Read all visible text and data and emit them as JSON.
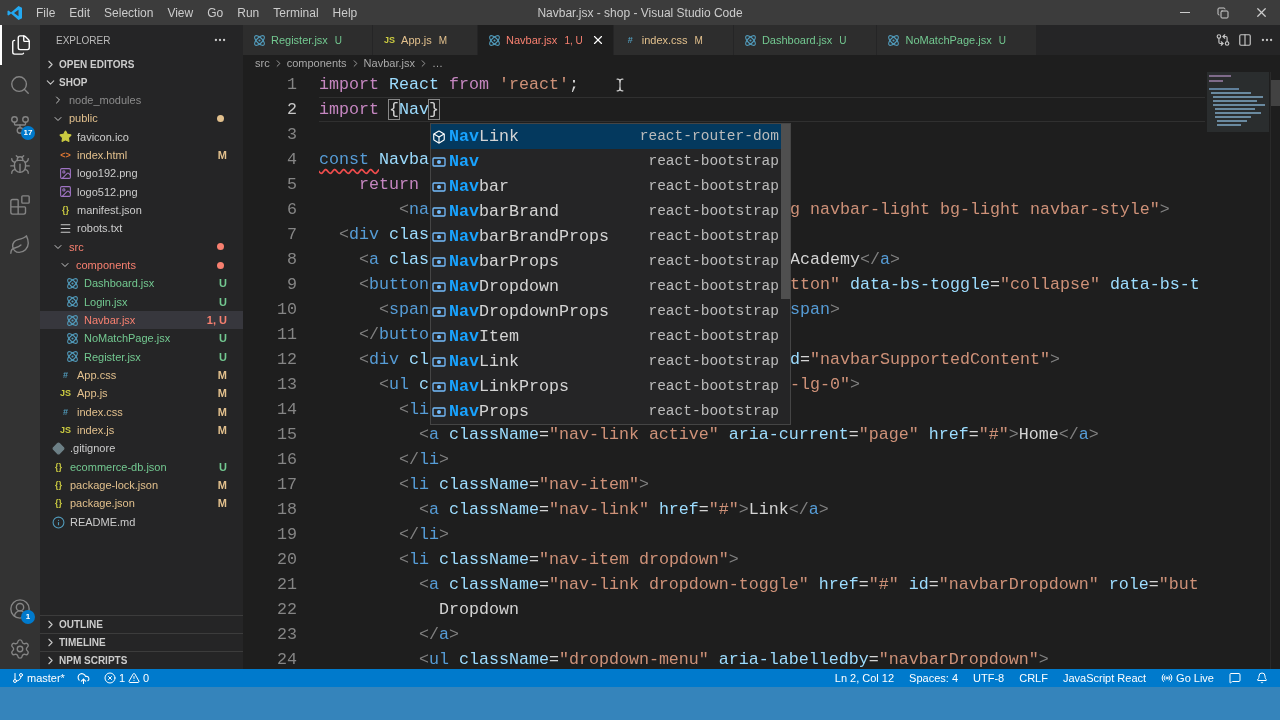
{
  "window": {
    "title": "Navbar.jsx - shop - Visual Studio Code"
  },
  "menu": [
    "File",
    "Edit",
    "Selection",
    "View",
    "Go",
    "Run",
    "Terminal",
    "Help"
  ],
  "activity_bar": {
    "top": [
      {
        "kind": "explorer",
        "selected": true
      },
      {
        "kind": "search",
        "selected": false
      },
      {
        "kind": "source_control",
        "selected": false,
        "badge": "17"
      },
      {
        "kind": "run",
        "selected": false
      },
      {
        "kind": "extensions",
        "selected": false
      },
      {
        "kind": "leaf",
        "selected": false
      }
    ],
    "bottom": [
      {
        "kind": "account",
        "badge": "1"
      },
      {
        "kind": "settings"
      }
    ]
  },
  "sidebar": {
    "title": "EXPLORER",
    "sections": [
      {
        "title": "OPEN EDITORS",
        "expanded": false
      },
      {
        "title": "SHOP",
        "expanded": true,
        "tree": [
          {
            "name": "node_modules",
            "kind": "folder",
            "expanded": false,
            "changed": false,
            "color": "#8c8c8c",
            "selected": false
          },
          {
            "name": "public",
            "kind": "folder",
            "expanded": true,
            "changed": true,
            "color": "#e2c08d",
            "selected": false,
            "children": [
              {
                "name": "favicon.ico",
                "kind": "favicon",
                "color": "#cccccc",
                "selected": false
              },
              {
                "name": "index.html",
                "kind": "html",
                "glyph": "<>",
                "color": "#e2c08d",
                "status": "M",
                "selected": false
              },
              {
                "name": "logo192.png",
                "kind": "image",
                "color": "#cccccc",
                "selected": false
              },
              {
                "name": "logo512.png",
                "kind": "image",
                "color": "#cccccc",
                "selected": false
              },
              {
                "name": "manifest.json",
                "kind": "json",
                "glyph": "{}",
                "color": "#cccccc",
                "selected": false
              },
              {
                "name": "robots.txt",
                "kind": "text",
                "color": "#cccccc",
                "selected": false
              }
            ]
          },
          {
            "name": "src",
            "kind": "folder",
            "expanded": true,
            "changed": true,
            "color": "#f88070",
            "selected": false,
            "children": [
              {
                "name": "components",
                "kind": "folder",
                "expanded": true,
                "changed": true,
                "color": "#f88070",
                "selected": false,
                "children": [
                  {
                    "name": "Dashboard.jsx",
                    "kind": "react",
                    "color": "#73c991",
                    "status": "U",
                    "selected": false
                  },
                  {
                    "name": "Login.jsx",
                    "kind": "react",
                    "color": "#73c991",
                    "status": "U",
                    "selected": false
                  },
                  {
                    "name": "Navbar.jsx",
                    "kind": "react",
                    "color": "#f88070",
                    "status": "1, U",
                    "selected": true
                  },
                  {
                    "name": "NoMatchPage.jsx",
                    "kind": "react",
                    "color": "#73c991",
                    "status": "U",
                    "selected": false
                  },
                  {
                    "name": "Register.jsx",
                    "kind": "react",
                    "color": "#73c991",
                    "status": "U",
                    "selected": false
                  }
                ]
              },
              {
                "name": "App.css",
                "kind": "css",
                "glyph": "#",
                "color": "#e2c08d",
                "status": "M",
                "selected": false
              },
              {
                "name": "App.js",
                "kind": "js",
                "glyph": "JS",
                "color": "#e2c08d",
                "status": "M",
                "selected": false
              },
              {
                "name": "index.css",
                "kind": "css",
                "glyph": "#",
                "color": "#e2c08d",
                "status": "M",
                "selected": false
              },
              {
                "name": "index.js",
                "kind": "js",
                "glyph": "JS",
                "color": "#e2c08d",
                "status": "M",
                "selected": false
              }
            ]
          },
          {
            "name": ".gitignore",
            "kind": "git",
            "color": "#cccccc",
            "selected": false
          },
          {
            "name": "ecommerce-db.json",
            "kind": "json",
            "glyph": "{}",
            "color": "#73c991",
            "status": "U",
            "selected": false
          },
          {
            "name": "package-lock.json",
            "kind": "json",
            "glyph": "{}",
            "color": "#e2c08d",
            "status": "M",
            "selected": false
          },
          {
            "name": "package.json",
            "kind": "json",
            "glyph": "{}",
            "color": "#e2c08d",
            "status": "M",
            "selected": false
          },
          {
            "name": "README.md",
            "kind": "info",
            "color": "#cccccc",
            "selected": false
          }
        ]
      }
    ],
    "bottom_sections": [
      {
        "title": "OUTLINE",
        "expanded": false
      },
      {
        "title": "TIMELINE",
        "expanded": false
      },
      {
        "title": "NPM SCRIPTS",
        "expanded": false
      }
    ]
  },
  "tabs": [
    {
      "label": "Register.jsx",
      "status": "U",
      "color": "#73c991",
      "kind": "react",
      "selected": false
    },
    {
      "label": "App.js",
      "status": "M",
      "color": "#e2c08d",
      "kind": "js",
      "glyph": "JS",
      "selected": false
    },
    {
      "label": "Navbar.jsx",
      "status": "1, U",
      "color": "#f88070",
      "kind": "react",
      "selected": true
    },
    {
      "label": "index.css",
      "status": "M",
      "color": "#e2c08d",
      "kind": "css",
      "glyph": "#",
      "selected": false
    },
    {
      "label": "Dashboard.jsx",
      "status": "U",
      "color": "#73c991",
      "kind": "react",
      "selected": false
    },
    {
      "label": "NoMatchPage.jsx",
      "status": "U",
      "color": "#73c991",
      "kind": "react",
      "selected": false
    }
  ],
  "breadcrumbs": [
    "src",
    "components",
    "Navbar.jsx",
    "…"
  ],
  "editor": {
    "lines": [
      {
        "number": "1",
        "current": false,
        "error": false,
        "tokens": [
          {
            "kind": "kw",
            "text": "import "
          },
          {
            "kind": "var",
            "text": "React "
          },
          {
            "kind": "kw",
            "text": "from "
          },
          {
            "kind": "str",
            "text": "'react'"
          },
          {
            "kind": "text",
            "text": ";"
          }
        ]
      },
      {
        "number": "2",
        "current": true,
        "error": false,
        "tokens": [
          {
            "kind": "kw",
            "text": "import "
          },
          {
            "kind": "bracket",
            "text": "{"
          },
          {
            "kind": "var",
            "text": "Nav"
          },
          {
            "kind": "bracket",
            "text": "}"
          }
        ]
      },
      {
        "number": "3",
        "current": false,
        "error": false
      },
      {
        "number": "4",
        "current": false,
        "error": true,
        "tokens": [
          {
            "kind": "decl",
            "text": "const "
          },
          {
            "kind": "var",
            "text": "Navba"
          }
        ]
      },
      {
        "number": "5",
        "current": false,
        "error": false,
        "tokens": [
          {
            "kind": "kw",
            "text": "    return"
          }
        ]
      },
      {
        "number": "6",
        "current": false,
        "error": false,
        "tokens": [
          {
            "kind": "punc",
            "text": "        <"
          },
          {
            "kind": "tag",
            "text": "na"
          }
        ],
        "right": [
          {
            "kind": "str",
            "text": "g navbar-light bg-light navbar-style\""
          },
          {
            "kind": "punc",
            "text": ">"
          }
        ]
      },
      {
        "number": "7",
        "current": false,
        "error": false,
        "tokens": [
          {
            "kind": "punc",
            "text": "  <"
          },
          {
            "kind": "tag",
            "text": "div "
          },
          {
            "kind": "attr",
            "text": "clas"
          }
        ]
      },
      {
        "number": "8",
        "current": false,
        "error": false,
        "tokens": [
          {
            "kind": "punc",
            "text": "    <"
          },
          {
            "kind": "tag",
            "text": "a "
          },
          {
            "kind": "attr",
            "text": "clas"
          }
        ],
        "right": [
          {
            "kind": "text",
            "text": "Academy"
          },
          {
            "kind": "punc",
            "text": "</"
          },
          {
            "kind": "tag",
            "text": "a"
          },
          {
            "kind": "punc",
            "text": ">"
          }
        ]
      },
      {
        "number": "9",
        "current": false,
        "error": false,
        "tokens": [
          {
            "kind": "punc",
            "text": "    <"
          },
          {
            "kind": "tag",
            "text": "button"
          }
        ],
        "right": [
          {
            "kind": "str",
            "text": "tton\" "
          },
          {
            "kind": "attr",
            "text": "data-bs-toggle"
          },
          {
            "kind": "text",
            "text": "="
          },
          {
            "kind": "str",
            "text": "\"collapse\" "
          },
          {
            "kind": "attr",
            "text": "data-bs-t"
          }
        ]
      },
      {
        "number": "10",
        "current": false,
        "error": false,
        "tokens": [
          {
            "kind": "punc",
            "text": "      <"
          },
          {
            "kind": "tag",
            "text": "span"
          }
        ],
        "right": [
          {
            "kind": "tag",
            "text": "span"
          },
          {
            "kind": "punc",
            "text": ">"
          }
        ]
      },
      {
        "number": "11",
        "current": false,
        "error": false,
        "tokens": [
          {
            "kind": "punc",
            "text": "    </"
          },
          {
            "kind": "tag",
            "text": "butto"
          }
        ]
      },
      {
        "number": "12",
        "current": false,
        "error": false,
        "tokens": [
          {
            "kind": "punc",
            "text": "    <"
          },
          {
            "kind": "tag",
            "text": "div "
          },
          {
            "kind": "attr",
            "text": "cl"
          }
        ],
        "right": [
          {
            "kind": "attr",
            "text": "d"
          },
          {
            "kind": "text",
            "text": "="
          },
          {
            "kind": "str",
            "text": "\"navbarSupportedContent\""
          },
          {
            "kind": "punc",
            "text": ">"
          }
        ]
      },
      {
        "number": "13",
        "current": false,
        "error": false,
        "tokens": [
          {
            "kind": "punc",
            "text": "      <"
          },
          {
            "kind": "tag",
            "text": "ul "
          },
          {
            "kind": "attr",
            "text": "c"
          }
        ],
        "right": [
          {
            "kind": "str",
            "text": "-lg-0\""
          },
          {
            "kind": "punc",
            "text": ">"
          }
        ]
      },
      {
        "number": "14",
        "current": false,
        "error": false,
        "tokens": [
          {
            "kind": "punc",
            "text": "        <"
          },
          {
            "kind": "tag",
            "text": "li"
          }
        ]
      },
      {
        "number": "15",
        "current": false,
        "error": false,
        "tokens": [
          {
            "kind": "punc",
            "text": "          <"
          },
          {
            "kind": "tag",
            "text": "a "
          },
          {
            "kind": "attr",
            "text": "className"
          },
          {
            "kind": "text",
            "text": "="
          },
          {
            "kind": "str",
            "text": "\"nav-link active\" "
          },
          {
            "kind": "attr",
            "text": "aria-current"
          },
          {
            "kind": "text",
            "text": "="
          },
          {
            "kind": "str",
            "text": "\"page\" "
          },
          {
            "kind": "attr",
            "text": "href"
          },
          {
            "kind": "text",
            "text": "="
          },
          {
            "kind": "str",
            "text": "\"#\""
          },
          {
            "kind": "punc",
            "text": ">"
          },
          {
            "kind": "text",
            "text": "Home"
          },
          {
            "kind": "punc",
            "text": "</"
          },
          {
            "kind": "tag",
            "text": "a"
          },
          {
            "kind": "punc",
            "text": ">"
          }
        ]
      },
      {
        "number": "16",
        "current": false,
        "error": false,
        "tokens": [
          {
            "kind": "punc",
            "text": "        </"
          },
          {
            "kind": "tag",
            "text": "li"
          },
          {
            "kind": "punc",
            "text": ">"
          }
        ]
      },
      {
        "number": "17",
        "current": false,
        "error": false,
        "tokens": [
          {
            "kind": "punc",
            "text": "        <"
          },
          {
            "kind": "tag",
            "text": "li "
          },
          {
            "kind": "attr",
            "text": "className"
          },
          {
            "kind": "text",
            "text": "="
          },
          {
            "kind": "str",
            "text": "\"nav-item\""
          },
          {
            "kind": "punc",
            "text": ">"
          }
        ]
      },
      {
        "number": "18",
        "current": false,
        "error": false,
        "tokens": [
          {
            "kind": "punc",
            "text": "          <"
          },
          {
            "kind": "tag",
            "text": "a "
          },
          {
            "kind": "attr",
            "text": "className"
          },
          {
            "kind": "text",
            "text": "="
          },
          {
            "kind": "str",
            "text": "\"nav-link\" "
          },
          {
            "kind": "attr",
            "text": "href"
          },
          {
            "kind": "text",
            "text": "="
          },
          {
            "kind": "str",
            "text": "\"#\""
          },
          {
            "kind": "punc",
            "text": ">"
          },
          {
            "kind": "text",
            "text": "Link"
          },
          {
            "kind": "punc",
            "text": "</"
          },
          {
            "kind": "tag",
            "text": "a"
          },
          {
            "kind": "punc",
            "text": ">"
          }
        ]
      },
      {
        "number": "19",
        "current": false,
        "error": false,
        "tokens": [
          {
            "kind": "punc",
            "text": "        </"
          },
          {
            "kind": "tag",
            "text": "li"
          },
          {
            "kind": "punc",
            "text": ">"
          }
        ]
      },
      {
        "number": "20",
        "current": false,
        "error": false,
        "tokens": [
          {
            "kind": "punc",
            "text": "        <"
          },
          {
            "kind": "tag",
            "text": "li "
          },
          {
            "kind": "attr",
            "text": "className"
          },
          {
            "kind": "text",
            "text": "="
          },
          {
            "kind": "str",
            "text": "\"nav-item dropdown\""
          },
          {
            "kind": "punc",
            "text": ">"
          }
        ]
      },
      {
        "number": "21",
        "current": false,
        "error": false,
        "tokens": [
          {
            "kind": "punc",
            "text": "          <"
          },
          {
            "kind": "tag",
            "text": "a "
          },
          {
            "kind": "attr",
            "text": "className"
          },
          {
            "kind": "text",
            "text": "="
          },
          {
            "kind": "str",
            "text": "\"nav-link dropdown-toggle\" "
          },
          {
            "kind": "attr",
            "text": "href"
          },
          {
            "kind": "text",
            "text": "="
          },
          {
            "kind": "str",
            "text": "\"#\" "
          },
          {
            "kind": "attr",
            "text": "id"
          },
          {
            "kind": "text",
            "text": "="
          },
          {
            "kind": "str",
            "text": "\"navbarDropdown\" "
          },
          {
            "kind": "attr",
            "text": "role"
          },
          {
            "kind": "text",
            "text": "="
          },
          {
            "kind": "str",
            "text": "\"but"
          }
        ]
      },
      {
        "number": "22",
        "current": false,
        "error": false,
        "tokens": [
          {
            "kind": "text",
            "text": "            Dropdown"
          }
        ]
      },
      {
        "number": "23",
        "current": false,
        "error": false,
        "tokens": [
          {
            "kind": "punc",
            "text": "          </"
          },
          {
            "kind": "tag",
            "text": "a"
          },
          {
            "kind": "punc",
            "text": ">"
          }
        ]
      },
      {
        "number": "24",
        "current": false,
        "error": false,
        "tokens": [
          {
            "kind": "punc",
            "text": "          <"
          },
          {
            "kind": "tag",
            "text": "ul "
          },
          {
            "kind": "attr",
            "text": "className"
          },
          {
            "kind": "text",
            "text": "="
          },
          {
            "kind": "str",
            "text": "\"dropdown-menu\" "
          },
          {
            "kind": "attr",
            "text": "aria-labelledby"
          },
          {
            "kind": "text",
            "text": "="
          },
          {
            "kind": "str",
            "text": "\"navbarDropdown\""
          },
          {
            "kind": "punc",
            "text": ">"
          }
        ]
      }
    ],
    "suggestions": [
      {
        "kind": "module",
        "match": "Nav",
        "rest": "Link",
        "source": "react-router-dom",
        "selected": true
      },
      {
        "kind": "field",
        "match": "Nav",
        "source": "react-bootstrap",
        "selected": false
      },
      {
        "kind": "field",
        "match": "Nav",
        "rest": "bar",
        "source": "react-bootstrap",
        "selected": false
      },
      {
        "kind": "field",
        "match": "Nav",
        "rest": "barBrand",
        "source": "react-bootstrap",
        "selected": false
      },
      {
        "kind": "field",
        "match": "Nav",
        "rest": "barBrandProps",
        "source": "react-bootstrap",
        "selected": false
      },
      {
        "kind": "field",
        "match": "Nav",
        "rest": "barProps",
        "source": "react-bootstrap",
        "selected": false
      },
      {
        "kind": "field",
        "match": "Nav",
        "rest": "Dropdown",
        "source": "react-bootstrap",
        "selected": false
      },
      {
        "kind": "field",
        "match": "Nav",
        "rest": "DropdownProps",
        "source": "react-bootstrap",
        "selected": false
      },
      {
        "kind": "field",
        "match": "Nav",
        "rest": "Item",
        "source": "react-bootstrap",
        "selected": false
      },
      {
        "kind": "field",
        "match": "Nav",
        "rest": "Link",
        "source": "react-bootstrap",
        "selected": false
      },
      {
        "kind": "field",
        "match": "Nav",
        "rest": "LinkProps",
        "source": "react-bootstrap",
        "selected": false
      },
      {
        "kind": "field",
        "match": "Nav",
        "rest": "Props",
        "source": "react-bootstrap",
        "selected": false
      }
    ]
  },
  "status_bar": {
    "branch": "master*",
    "errors": "1",
    "warnings": "0",
    "items": [
      "Ln 2, Col 12",
      "Spaces: 4",
      "UTF-8",
      "CRLF",
      "JavaScript React"
    ],
    "go_live": "Go Live"
  }
}
